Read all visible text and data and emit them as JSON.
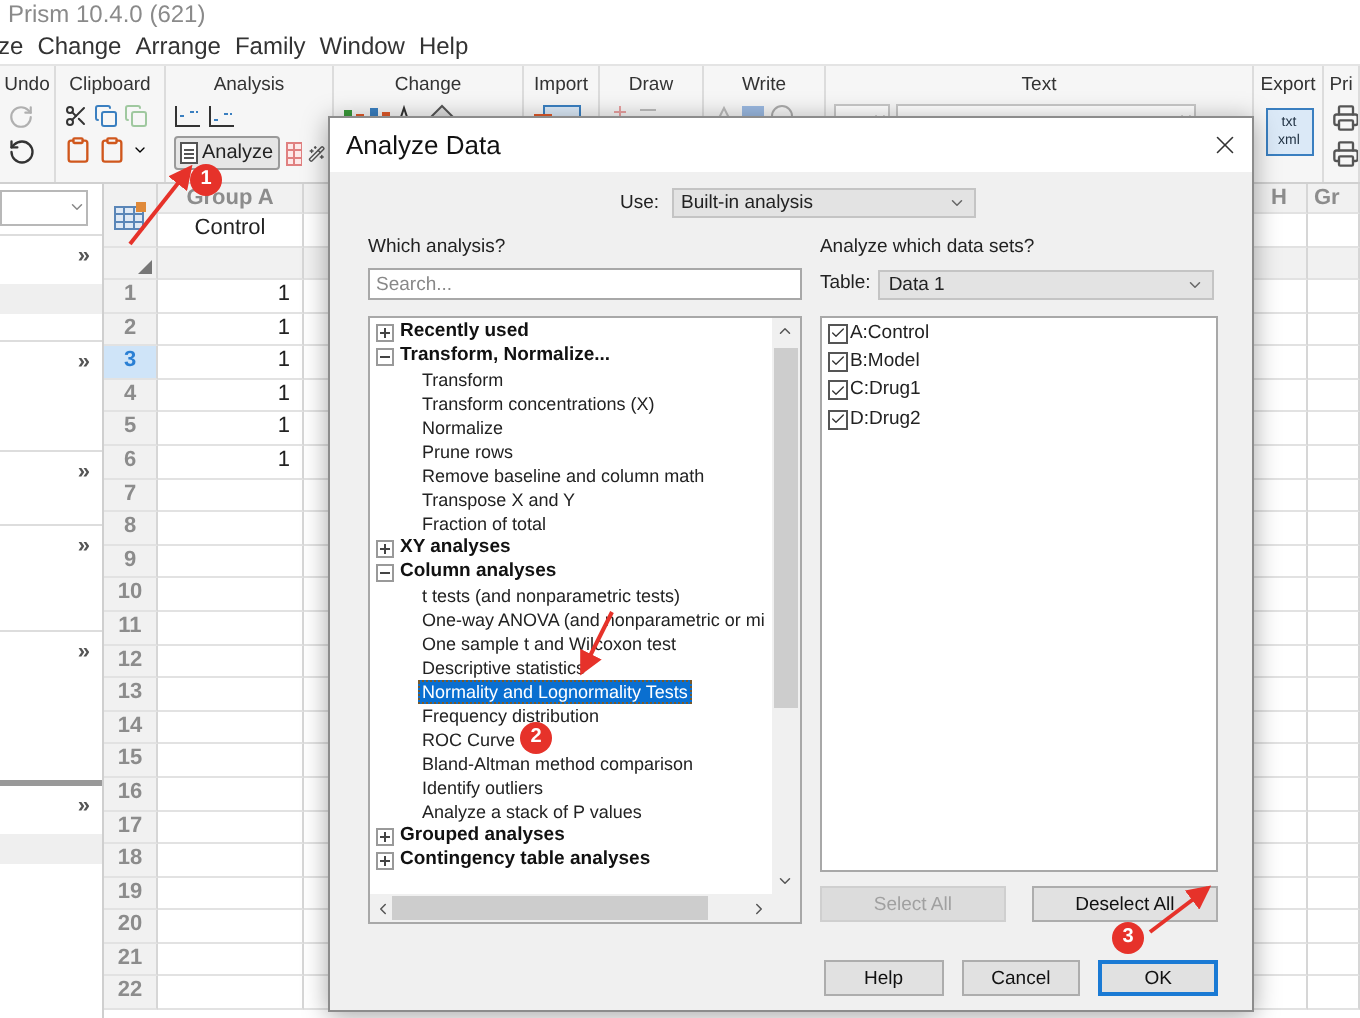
{
  "window": {
    "title": "Prism 10.4.0 (621)"
  },
  "menu": [
    "ze",
    "Change",
    "Arrange",
    "Family",
    "Window",
    "Help"
  ],
  "ribbon": {
    "groups": [
      {
        "label": "Undo"
      },
      {
        "label": "Clipboard"
      },
      {
        "label": "Analysis"
      },
      {
        "label": "Change"
      },
      {
        "label": "Import"
      },
      {
        "label": "Draw"
      },
      {
        "label": "Write"
      },
      {
        "label": "Text"
      },
      {
        "label": "Export"
      },
      {
        "label": "Pri"
      }
    ],
    "analyze_button": "Analyze",
    "export_icon_text": [
      "txt",
      "xml"
    ]
  },
  "navigator": {
    "sections": [
      {
        "chevron": "»"
      },
      {
        "chevron": "»"
      },
      {
        "chevron": "»"
      },
      {
        "chevron": "»"
      },
      {
        "chevron": "»"
      },
      {
        "chevron": "»"
      }
    ]
  },
  "sheet": {
    "column_a": {
      "title": "Group A",
      "subtitle": "Control",
      "values": [
        "1",
        "1",
        "1",
        "1",
        "1",
        "1"
      ]
    },
    "right_columns": [
      {
        "title": "H"
      },
      {
        "title": "Gr"
      }
    ],
    "rows": [
      {
        "number": "1",
        "selected": false
      },
      {
        "number": "2",
        "selected": false
      },
      {
        "number": "3",
        "selected": true
      },
      {
        "number": "4",
        "selected": false
      },
      {
        "number": "5",
        "selected": false
      },
      {
        "number": "6",
        "selected": false
      },
      {
        "number": "7",
        "selected": false
      },
      {
        "number": "8",
        "selected": false
      },
      {
        "number": "9",
        "selected": false
      },
      {
        "number": "10",
        "selected": false
      },
      {
        "number": "11",
        "selected": false
      },
      {
        "number": "12",
        "selected": false
      },
      {
        "number": "13",
        "selected": false
      },
      {
        "number": "14",
        "selected": false
      },
      {
        "number": "15",
        "selected": false
      },
      {
        "number": "16",
        "selected": false
      },
      {
        "number": "17",
        "selected": false
      },
      {
        "number": "18",
        "selected": false
      },
      {
        "number": "19",
        "selected": false
      },
      {
        "number": "20",
        "selected": false
      },
      {
        "number": "21",
        "selected": false
      },
      {
        "number": "22",
        "selected": false
      }
    ]
  },
  "dialog": {
    "title": "Analyze Data",
    "use_label": "Use:",
    "use_value": "Built-in analysis",
    "which_label": "Which analysis?",
    "search_placeholder": "Search...",
    "tree": [
      {
        "label": "Recently used",
        "expanded": false
      },
      {
        "label": "Transform, Normalize...",
        "expanded": true,
        "children": [
          {
            "label": "Transform",
            "selected": false
          },
          {
            "label": "Transform concentrations (X)",
            "selected": false
          },
          {
            "label": "Normalize",
            "selected": false
          },
          {
            "label": "Prune rows",
            "selected": false
          },
          {
            "label": "Remove baseline and column math",
            "selected": false
          },
          {
            "label": "Transpose X and Y",
            "selected": false
          },
          {
            "label": "Fraction of total",
            "selected": false
          }
        ]
      },
      {
        "label": "XY analyses",
        "expanded": false
      },
      {
        "label": "Column analyses",
        "expanded": true,
        "children": [
          {
            "label": "t tests (and nonparametric tests)",
            "selected": false
          },
          {
            "label": "One-way ANOVA (and nonparametric or mi",
            "selected": false
          },
          {
            "label": "One sample t and Wilcoxon test",
            "selected": false
          },
          {
            "label": "Descriptive statistics",
            "selected": false
          },
          {
            "label": "Normality and Lognormality Tests",
            "selected": true
          },
          {
            "label": "Frequency distribution",
            "selected": false
          },
          {
            "label": "ROC Curve",
            "selected": false
          },
          {
            "label": "Bland-Altman method comparison",
            "selected": false
          },
          {
            "label": "Identify outliers",
            "selected": false
          },
          {
            "label": "Analyze a stack of P values",
            "selected": false
          }
        ]
      },
      {
        "label": "Grouped analyses",
        "expanded": false
      },
      {
        "label": "Contingency table analyses",
        "expanded": false
      }
    ],
    "datasets_label": "Analyze which data sets?",
    "table_label": "Table:",
    "table_value": "Data 1",
    "datasets": [
      {
        "label": "A:Control",
        "checked": true
      },
      {
        "label": "B:Model",
        "checked": true
      },
      {
        "label": "C:Drug1",
        "checked": true
      },
      {
        "label": "D:Drug2",
        "checked": true
      }
    ],
    "select_buttons": [
      {
        "label": "Select All",
        "disabled": true
      },
      {
        "label": "Deselect All",
        "disabled": false
      }
    ],
    "footer_buttons": [
      {
        "label": "Help",
        "default": false
      },
      {
        "label": "Cancel",
        "default": false
      },
      {
        "label": "OK",
        "default": true
      }
    ]
  },
  "annotations": [
    {
      "number": "1"
    },
    {
      "number": "2"
    },
    {
      "number": "3"
    }
  ]
}
